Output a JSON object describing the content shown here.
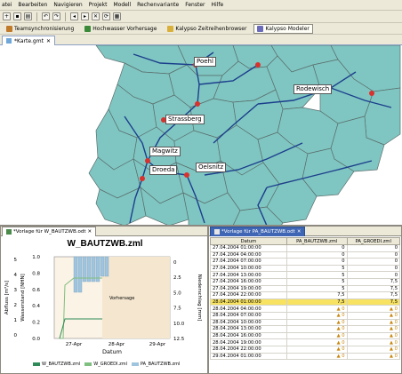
{
  "menu": [
    "atei",
    "Bearbeiten",
    "Navigieren",
    "Projekt",
    "Modell",
    "Rechenvariante",
    "Fenster",
    "Hilfe"
  ],
  "perspectives": [
    {
      "label": "Teamsynchronisierung",
      "color": "#c07a2a"
    },
    {
      "label": "Hochwasser Vorhersage",
      "color": "#3a8a3a"
    },
    {
      "label": "Kalypso Zeitreihenbrowser",
      "color": "#d9b03a"
    },
    {
      "label": "Kalypso Modeler",
      "color": "#6b6bbb"
    }
  ],
  "editor_tab": {
    "label": "*Karte.gmt"
  },
  "map": {
    "towns": [
      "Poehl",
      "Rodewisch",
      "Strassberg",
      "Magwitz",
      "Oelsnitz",
      "Droeda"
    ]
  },
  "left_panel": {
    "tab_label": "*Vorlage für W_BAUTZWB.odt",
    "chart_title": "W_BAUTZWB.zml"
  },
  "chart_data": {
    "type": "line",
    "title": "W_BAUTZWB.zml",
    "xlabel": "Datum",
    "ylabel_left_outer": "Abfluss [m³/s]",
    "ylabel_left_inner": "Wasserstand [NHN]",
    "ylabel_right": "Niederschlag [mm]",
    "x_ticks": [
      "27-Apr",
      "28-Apr",
      "29-Apr"
    ],
    "y_outer_ticks": [
      "0",
      "1",
      "2",
      "3",
      "4",
      "5"
    ],
    "y_inner_ticks": [
      "0.0",
      "0.2",
      "0.4",
      "0.6",
      "0.8",
      "1.0"
    ],
    "y_right_ticks": [
      "0",
      "2.5",
      "5.0",
      "7.5",
      "10.0",
      "12.5"
    ],
    "annotation": "Vorhersage",
    "series": [
      {
        "name": "W_BAUTZWB.zml",
        "color": "#2e8b57"
      },
      {
        "name": "W_GROEDI.zml",
        "color": "#7fbf7f"
      },
      {
        "name": "PA_BAUTZWB.zml",
        "color": "#9ec4de"
      }
    ]
  },
  "right_panel": {
    "tab_label": "*Vorlage für PA_BAUTZWB.odt",
    "columns": [
      "Datum",
      "PA_BAUTZWB.zml",
      "PA_GROEDI.zml"
    ],
    "rows": [
      [
        "27.04.2004 01:00:00",
        "0",
        "0"
      ],
      [
        "27.04.2004 04:00:00",
        "0",
        "0"
      ],
      [
        "27.04.2004 07:00:00",
        "0",
        "0"
      ],
      [
        "27.04.2004 10:00:00",
        "5",
        "0"
      ],
      [
        "27.04.2004 13:00:00",
        "5",
        "0"
      ],
      [
        "27.04.2004 16:00:00",
        "5",
        "7,5"
      ],
      [
        "27.04.2004 19:00:00",
        "5",
        "7,5"
      ],
      [
        "27.04.2004 22:00:00",
        "7,5",
        "7,5"
      ],
      [
        "28.04.2004 01:00:00",
        "7,5",
        "7,5"
      ],
      [
        "28.04.2004 04:00:00",
        "0",
        "0"
      ],
      [
        "28.04.2004 07:00:00",
        "0",
        "0"
      ],
      [
        "28.04.2004 10:00:00",
        "0",
        "0"
      ],
      [
        "28.04.2004 13:00:00",
        "0",
        "0"
      ],
      [
        "28.04.2004 16:00:00",
        "0",
        "0"
      ],
      [
        "28.04.2004 19:00:00",
        "0",
        "0"
      ],
      [
        "28.04.2004 22:00:00",
        "0",
        "0"
      ],
      [
        "29.04.2004 01:00:00",
        "0",
        "0"
      ]
    ],
    "warn_rows_from": 9,
    "highlight_row": 8
  },
  "colors": {
    "catchment": "#7fc6c2",
    "river": "#1c3f8c",
    "gauge": "#d9322e",
    "highlight": "#f7e262"
  }
}
